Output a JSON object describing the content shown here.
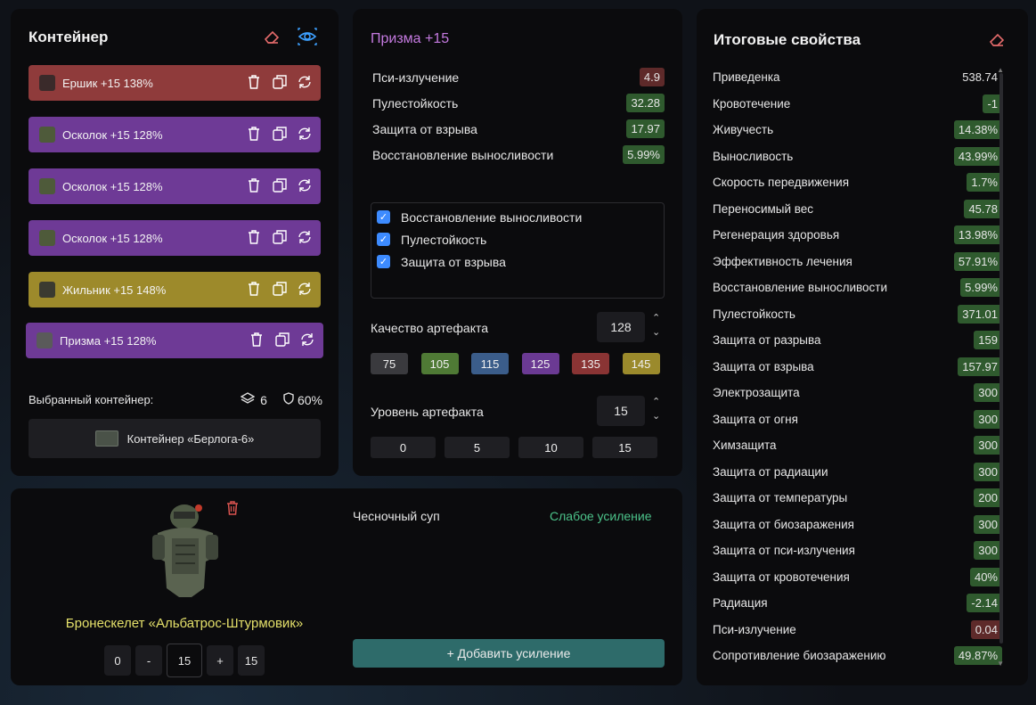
{
  "container": {
    "title": "Контейнер",
    "artifacts": [
      {
        "label": "Ершик +15 138%",
        "color": "#8f3b3b"
      },
      {
        "label": "Осколок +15 128%",
        "color": "#6e3a96"
      },
      {
        "label": "Осколок +15 128%",
        "color": "#6e3a96"
      },
      {
        "label": "Осколок +15 128%",
        "color": "#6e3a96"
      },
      {
        "label": "Жильник +15 148%",
        "color": "#9d8a2b"
      },
      {
        "label": "Призма +15 128%",
        "color": "#6e3a96"
      }
    ],
    "selected_label": "Выбранный контейнер:",
    "slots": "6",
    "protection": "60%",
    "container_name": "Контейнер «Берлога-6»"
  },
  "prism": {
    "title": "Призма +15",
    "props": [
      {
        "name": "Пси-излучение",
        "value": "4.9",
        "tone": "red"
      },
      {
        "name": "Пулестойкость",
        "value": "32.28",
        "tone": "green"
      },
      {
        "name": "Защита от взрыва",
        "value": "17.97",
        "tone": "green"
      },
      {
        "name": "Восстановление выносливости",
        "value": "5.99%",
        "tone": "green"
      }
    ],
    "checks": [
      "Восстановление выносливости",
      "Пулестойкость",
      "Защита от взрыва"
    ],
    "quality_label": "Качество артефакта",
    "quality_value": "128",
    "quality_chips": [
      {
        "v": "75",
        "color": "#3a3a3e"
      },
      {
        "v": "105",
        "color": "#4f7a35"
      },
      {
        "v": "115",
        "color": "#3b5d8a"
      },
      {
        "v": "125",
        "color": "#6b3a93"
      },
      {
        "v": "135",
        "color": "#8a3434"
      },
      {
        "v": "145",
        "color": "#9b8a2c"
      }
    ],
    "level_label": "Уровень артефакта",
    "level_value": "15",
    "level_chips": [
      "0",
      "5",
      "10",
      "15"
    ]
  },
  "armor": {
    "name": "Бронескелет «Альбатрос-Штурмовик»",
    "boost_name": "Чесночный суп",
    "boost_level": "Слабое усиление",
    "add_boost": "+ Добавить усиление",
    "steps": {
      "min": "0",
      "minus": "-",
      "value": "15",
      "plus": "+",
      "max": "15"
    }
  },
  "totals": {
    "title": "Итоговые свойства",
    "stats": [
      {
        "name": "Приведенка",
        "value": "538.74",
        "tone": "none"
      },
      {
        "name": "Кровотечение",
        "value": "-1",
        "tone": "green"
      },
      {
        "name": "Живучесть",
        "value": "14.38%",
        "tone": "green"
      },
      {
        "name": "Выносливость",
        "value": "43.99%",
        "tone": "green"
      },
      {
        "name": "Скорость передвижения",
        "value": "1.7%",
        "tone": "green"
      },
      {
        "name": "Переносимый вес",
        "value": "45.78",
        "tone": "green"
      },
      {
        "name": "Регенерация здоровья",
        "value": "13.98%",
        "tone": "green"
      },
      {
        "name": "Эффективность лечения",
        "value": "57.91%",
        "tone": "green"
      },
      {
        "name": "Восстановление выносливости",
        "value": "5.99%",
        "tone": "green"
      },
      {
        "name": "Пулестойкость",
        "value": "371.01",
        "tone": "green"
      },
      {
        "name": "Защита от разрыва",
        "value": "159",
        "tone": "green"
      },
      {
        "name": "Защита от взрыва",
        "value": "157.97",
        "tone": "green"
      },
      {
        "name": "Электрозащита",
        "value": "300",
        "tone": "green"
      },
      {
        "name": "Защита от огня",
        "value": "300",
        "tone": "green"
      },
      {
        "name": "Химзащита",
        "value": "300",
        "tone": "green"
      },
      {
        "name": "Защита от радиации",
        "value": "300",
        "tone": "green"
      },
      {
        "name": "Защита от температуры",
        "value": "200",
        "tone": "green"
      },
      {
        "name": "Защита от биозаражения",
        "value": "300",
        "tone": "green"
      },
      {
        "name": "Защита от пси-излучения",
        "value": "300",
        "tone": "green"
      },
      {
        "name": "Защита от кровотечения",
        "value": "40%",
        "tone": "green"
      },
      {
        "name": "Радиация",
        "value": "-2.14",
        "tone": "green"
      },
      {
        "name": "Пси-излучение",
        "value": "0.04",
        "tone": "red"
      },
      {
        "name": "Сопротивление биозаражению",
        "value": "49.87%",
        "tone": "green"
      }
    ]
  }
}
